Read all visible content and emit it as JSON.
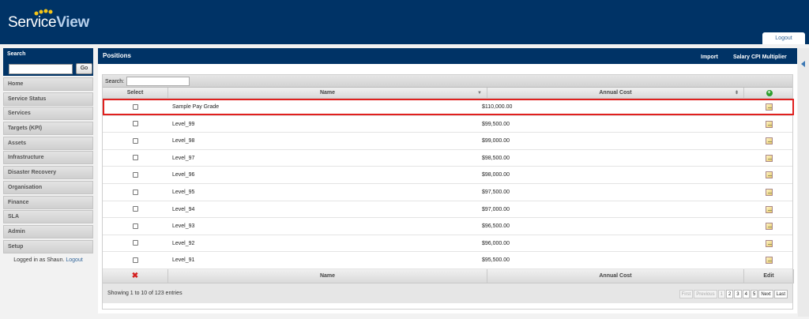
{
  "header": {
    "logo_part1": "Service",
    "logo_part2": "View",
    "logout_tab": "Logout"
  },
  "sidebar": {
    "search_title": "Search",
    "search_value": "",
    "go_label": "Go",
    "items": [
      {
        "label": "Home"
      },
      {
        "label": "Service Status"
      },
      {
        "label": "Services"
      },
      {
        "label": "Targets (KPI)"
      },
      {
        "label": "Assets"
      },
      {
        "label": "Infrastructure"
      },
      {
        "label": "Disaster Recovery"
      },
      {
        "label": "Organisation"
      },
      {
        "label": "Finance"
      },
      {
        "label": "SLA"
      },
      {
        "label": "Admin"
      },
      {
        "label": "Setup"
      }
    ],
    "logged_in_text": "Logged in as Shaun.",
    "logout_link": "Logout"
  },
  "panel": {
    "title": "Positions",
    "import_label": "Import",
    "salary_label": "Salary CPI Multiplier"
  },
  "grid": {
    "search_label": "Search:",
    "search_value": "",
    "columns": {
      "select": "Select",
      "name": "Name",
      "cost": "Annual Cost"
    },
    "rows": [
      {
        "name": "Sample Pay Grade",
        "cost": "$110,000.00"
      },
      {
        "name": "Level_99",
        "cost": "$99,500.00"
      },
      {
        "name": "Level_98",
        "cost": "$99,000.00"
      },
      {
        "name": "Level_97",
        "cost": "$98,500.00"
      },
      {
        "name": "Level_96",
        "cost": "$98,000.00"
      },
      {
        "name": "Level_95",
        "cost": "$97,500.00"
      },
      {
        "name": "Level_94",
        "cost": "$97,000.00"
      },
      {
        "name": "Level_93",
        "cost": "$96,500.00"
      },
      {
        "name": "Level_92",
        "cost": "$96,000.00"
      },
      {
        "name": "Level_91",
        "cost": "$95,500.00"
      }
    ],
    "footer": {
      "name": "Name",
      "cost": "Annual Cost",
      "edit": "Edit"
    },
    "pager": {
      "info": "Showing 1 to 10 of 123 entries",
      "first": "First",
      "previous": "Previous",
      "pages": [
        "1",
        "2",
        "3",
        "4",
        "5"
      ],
      "next": "Next",
      "last": "Last"
    }
  },
  "colors": {
    "brand": "#003366",
    "highlight": "#e0201e"
  }
}
